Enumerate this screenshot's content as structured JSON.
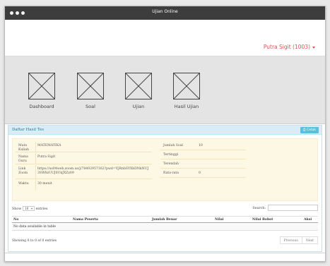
{
  "window": {
    "title": "Ujian Online"
  },
  "navbar": {
    "user": "Putra Sigit (1003)"
  },
  "menu": [
    {
      "label": "Dashboard",
      "icon": "image-placeholder-icon"
    },
    {
      "label": "Soal",
      "icon": "image-placeholder-icon"
    },
    {
      "label": "Ujian",
      "icon": "image-placeholder-icon"
    },
    {
      "label": "Hasil Ujian",
      "icon": "image-placeholder-icon"
    }
  ],
  "panel": {
    "title": "Daftar Hasil Tes",
    "print_label": "Cetak",
    "info_left": [
      {
        "label": "Mata Kuliah",
        "value": "MATEMATIKA"
      },
      {
        "label": "Nama Guru",
        "value": "Putra Sigit"
      },
      {
        "label": "Link Zoom",
        "value": "https://us04web.zoom.us/j/78492957162?pwd=VjRnbSYXbDNkNUJ3SW8zUUJ0UkJXZz09"
      },
      {
        "label": "Waktu",
        "value": "30 menit"
      }
    ],
    "info_right": [
      {
        "label": "Jumlah Soal",
        "value": "10"
      },
      {
        "label": "Tertinggi",
        "value": ""
      },
      {
        "label": "Terendah",
        "value": ""
      },
      {
        "label": "Rata-rata",
        "value": "0"
      }
    ]
  },
  "table": {
    "show_label": "Show",
    "entries_value": "10",
    "entries_label": "entries",
    "search_label": "Search:",
    "columns": [
      "No",
      "Nama Peserta",
      "Jumlah Benar",
      "Nilai",
      "Nilai Bobot",
      "Aksi"
    ],
    "empty_text": "No data available in table",
    "info": "Showing 0 to 0 of 0 entries",
    "previous": "Previous",
    "next": "Next"
  },
  "colors": {
    "titlebar": "#3d3d3d",
    "user": "#d9534f",
    "panel_head": "#d9edf7",
    "info_bg": "#fcf8e3",
    "print_button": "#5bc0de"
  }
}
